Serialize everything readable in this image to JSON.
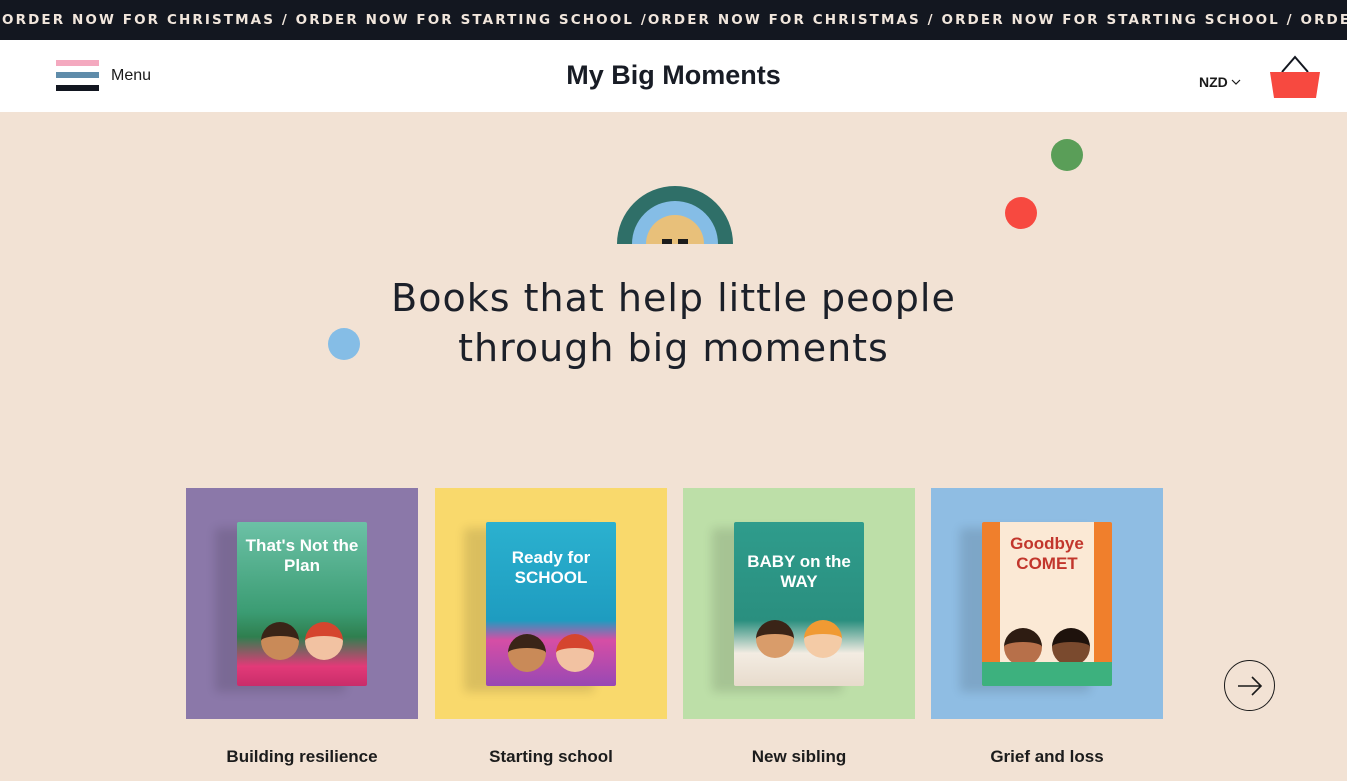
{
  "announcement": "ORDER NOW FOR CHRISTMAS / ORDER NOW FOR STARTING SCHOOL /ORDER NOW FOR CHRISTMAS / ORDER NOW FOR STARTING SCHOOL / ORDER NOW FOR",
  "header": {
    "menu_label": "Menu",
    "brand": "My Big Moments",
    "currency": "NZD",
    "cart_icon": "basket-icon"
  },
  "hero": {
    "line1": "Books that help little people",
    "line2": "through big moments"
  },
  "categories": [
    {
      "label": "Building resilience",
      "book_title": "That's Not the Plan",
      "color": "#8b78a9"
    },
    {
      "label": "Starting school",
      "book_title": "Ready for SCHOOL",
      "color": "#f9d96c"
    },
    {
      "label": "New sibling",
      "book_title": "BABY on the WAY",
      "color": "#bddfa8"
    },
    {
      "label": "Grief and loss",
      "book_title": "Goodbye COMET",
      "color": "#8fbde3"
    }
  ],
  "colors": {
    "ticker_bg": "#131720",
    "page_bg": "#f2e2d4",
    "accent_red": "#f74940",
    "accent_green": "#5a9e58",
    "accent_blue": "#85bde6"
  }
}
